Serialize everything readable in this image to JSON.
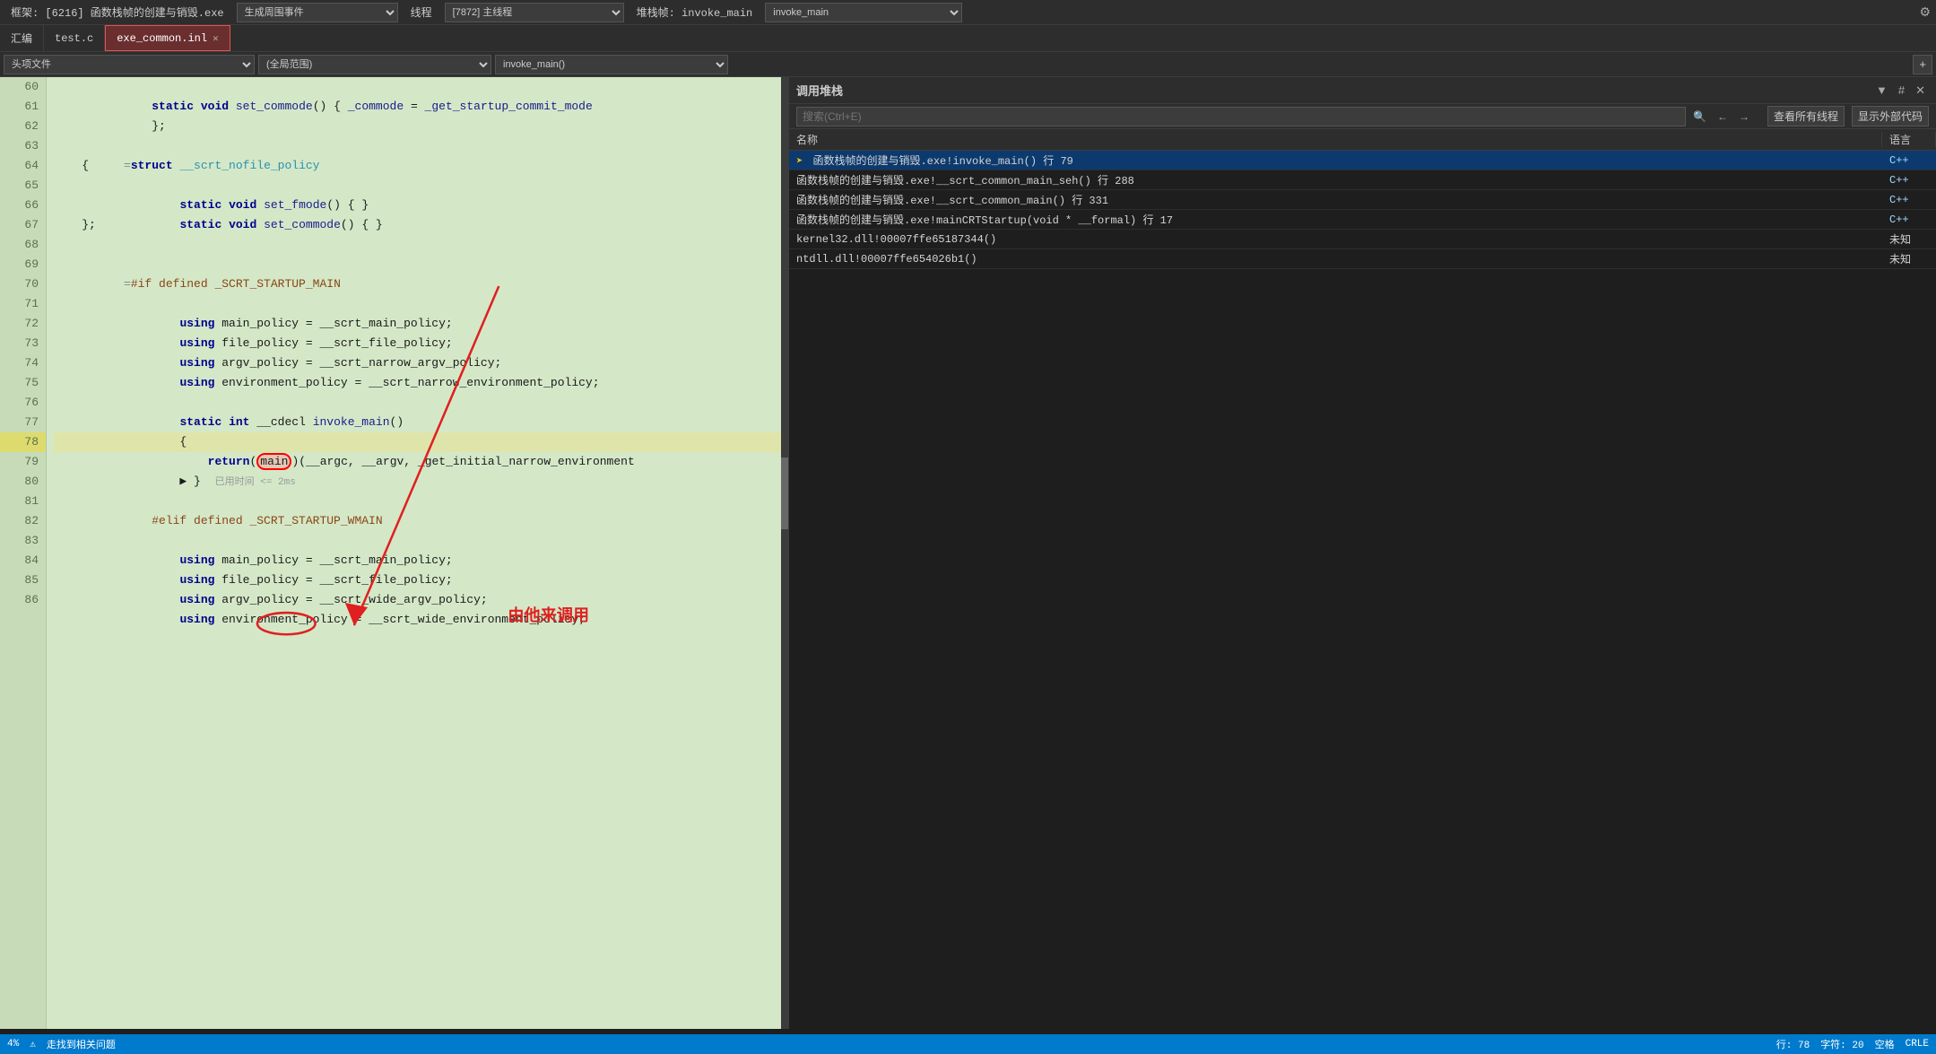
{
  "topbar": {
    "debug_title": "框架: [6216] 函数栈帧的创建与销毁.exe",
    "thread_label": "生成周围事件",
    "thread_type": "线程",
    "thread_id": "[7872] 主线程",
    "stack_label": "堆栈帧: invoke_main"
  },
  "tabs": [
    {
      "id": "tab-compile",
      "label": "汇编"
    },
    {
      "id": "tab-test",
      "label": "test.c"
    },
    {
      "id": "tab-exe-common",
      "label": "exe_common.inl",
      "active": true,
      "highlighted": true
    }
  ],
  "toolbar": {
    "nav_placeholder": "头项文件",
    "scope_placeholder": "(全局范围)",
    "func_placeholder": "invoke_main()",
    "add_btn": "+"
  },
  "code": {
    "lines": [
      {
        "num": 60,
        "text": "    static void set_commode() { _commode = _get_startup_commit_mode"
      },
      {
        "num": 61,
        "text": "    };"
      },
      {
        "num": 62,
        "text": ""
      },
      {
        "num": 63,
        "text": "=struct __scrt_nofile_policy"
      },
      {
        "num": 64,
        "text": "    {"
      },
      {
        "num": 65,
        "text": "        static void set_fmode() { }"
      },
      {
        "num": 66,
        "text": "        static void set_commode() { }"
      },
      {
        "num": 67,
        "text": "    };"
      },
      {
        "num": 68,
        "text": ""
      },
      {
        "num": 69,
        "text": "=#if defined _SCRT_STARTUP_MAIN"
      },
      {
        "num": 70,
        "text": ""
      },
      {
        "num": 71,
        "text": "        using main_policy = __scrt_main_policy;"
      },
      {
        "num": 72,
        "text": "        using file_policy = __scrt_file_policy;"
      },
      {
        "num": 73,
        "text": "        using argv_policy = __scrt_narrow_argv_policy;"
      },
      {
        "num": 74,
        "text": "        using environment_policy = __scrt_narrow_environment_policy;"
      },
      {
        "num": 75,
        "text": ""
      },
      {
        "num": 76,
        "text": "        static int __cdecl invoke_main()"
      },
      {
        "num": 77,
        "text": "        {"
      },
      {
        "num": 78,
        "text": "            return(main)(__argc, __argv, _get_initial_narrow_environment",
        "active": true
      },
      {
        "num": 79,
        "text": "        ▶ }  已用时间 <= 2ms"
      },
      {
        "num": 80,
        "text": ""
      },
      {
        "num": 81,
        "text": "    #elif defined _SCRT_STARTUP_WMAIN"
      },
      {
        "num": 82,
        "text": ""
      },
      {
        "num": 83,
        "text": "        using main_policy = __scrt_main_policy;"
      },
      {
        "num": 84,
        "text": "        using file_policy = __scrt_file_policy;"
      },
      {
        "num": 85,
        "text": "        using argv_policy = __scrt_wide_argv_policy;"
      },
      {
        "num": 86,
        "text": "        using environment_policy = __scrt_wide_environment_policy;"
      }
    ]
  },
  "annotation": {
    "label": "由他来调用",
    "arrow_from": "invoke_main tab",
    "circle_text": "main"
  },
  "callstack": {
    "title": "调用堆栈",
    "search_placeholder": "搜索(Ctrl+E)",
    "view_all_label": "查看所有线程",
    "show_external_label": "显示外部代码",
    "columns": [
      {
        "id": "name",
        "label": "名称"
      },
      {
        "id": "lang",
        "label": "语言"
      }
    ],
    "rows": [
      {
        "id": "row-0",
        "name": "函数栈帧的创建与销毁.exe!invoke_main() 行 79",
        "lang": "C++",
        "active": true,
        "arrow": true
      },
      {
        "id": "row-1",
        "name": "函数栈帧的创建与销毁.exe!__scrt_common_main_seh() 行 288",
        "lang": "C++",
        "active": false
      },
      {
        "id": "row-2",
        "name": "函数栈帧的创建与销毁.exe!__scrt_common_main() 行 331",
        "lang": "C++",
        "active": false
      },
      {
        "id": "row-3",
        "name": "函数栈帧的创建与销毁.exe!mainCRTStartup(void * __formal) 行 17",
        "lang": "C++",
        "active": false
      },
      {
        "id": "row-4",
        "name": "kernel32.dll!00007ffe65187344()",
        "lang": "未知",
        "active": false
      },
      {
        "id": "row-5",
        "name": "ntdll.dll!00007ffe654026b1()",
        "lang": "未知",
        "active": false
      }
    ]
  },
  "statusbar": {
    "zoom": "4%",
    "error_label": "走找到相关问题",
    "line": "行: 78",
    "char": "字符: 20",
    "space": "空格",
    "encoding": "CRLE"
  }
}
